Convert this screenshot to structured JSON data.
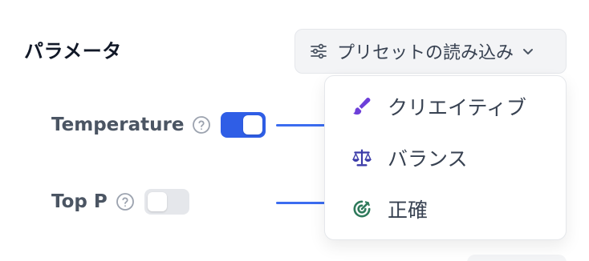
{
  "section": {
    "title": "パラメータ"
  },
  "preset_button": {
    "label": "プリセットの読み込み",
    "icon": "sliders-icon",
    "chevron": "chevron-down-icon"
  },
  "parameters": [
    {
      "label": "Temperature",
      "help_icon": "question-circle-icon",
      "enabled": true
    },
    {
      "label": "Top P",
      "help_icon": "question-circle-icon",
      "enabled": false
    }
  ],
  "preset_menu": {
    "items": [
      {
        "label": "クリエイティブ",
        "icon": "brush-icon",
        "icon_color": "#6d3fd9"
      },
      {
        "label": "バランス",
        "icon": "scale-icon",
        "icon_color": "#3b3ba8"
      },
      {
        "label": "正確",
        "icon": "target-icon",
        "icon_color": "#2f7a5b"
      }
    ]
  },
  "colors": {
    "accent": "#2f5ee6",
    "slider": "#3b6cf0"
  }
}
